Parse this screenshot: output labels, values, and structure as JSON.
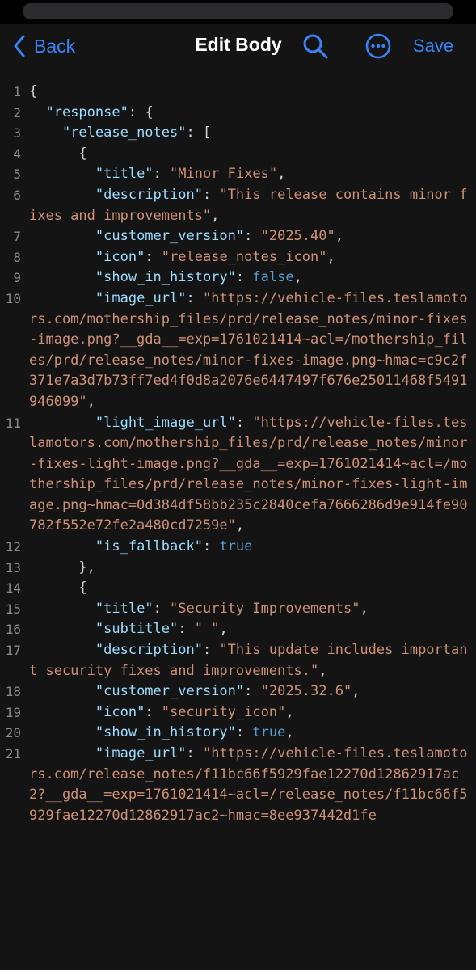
{
  "nav": {
    "back_label": "Back",
    "title": "Edit Body",
    "save_label": "Save",
    "search_icon": "search-icon",
    "more_icon": "ellipsis-circle-icon",
    "accent": "#3b82f6"
  },
  "editor": {
    "lines": [
      {
        "n": "1",
        "segments": [
          {
            "t": "p",
            "v": "{"
          }
        ]
      },
      {
        "n": "2",
        "segments": [
          {
            "t": "p",
            "v": "  "
          },
          {
            "t": "k",
            "v": "\"response\""
          },
          {
            "t": "p",
            "v": ": {"
          }
        ]
      },
      {
        "n": "3",
        "segments": [
          {
            "t": "p",
            "v": "    "
          },
          {
            "t": "k",
            "v": "\"release_notes\""
          },
          {
            "t": "p",
            "v": ": ["
          }
        ]
      },
      {
        "n": "4",
        "segments": [
          {
            "t": "p",
            "v": "      {"
          }
        ]
      },
      {
        "n": "5",
        "segments": [
          {
            "t": "p",
            "v": "        "
          },
          {
            "t": "k",
            "v": "\"title\""
          },
          {
            "t": "p",
            "v": ": "
          },
          {
            "t": "s",
            "v": "\"Minor Fixes\""
          },
          {
            "t": "p",
            "v": ","
          }
        ]
      },
      {
        "n": "6",
        "segments": [
          {
            "t": "p",
            "v": "        "
          },
          {
            "t": "k",
            "v": "\"description\""
          },
          {
            "t": "p",
            "v": ": "
          },
          {
            "t": "s",
            "v": "\"This release contains minor fixes and improvements\""
          },
          {
            "t": "p",
            "v": ","
          }
        ]
      },
      {
        "n": "7",
        "segments": [
          {
            "t": "p",
            "v": "        "
          },
          {
            "t": "k",
            "v": "\"customer_version\""
          },
          {
            "t": "p",
            "v": ": "
          },
          {
            "t": "s",
            "v": "\"2025.40\""
          },
          {
            "t": "p",
            "v": ","
          }
        ]
      },
      {
        "n": "8",
        "segments": [
          {
            "t": "p",
            "v": "        "
          },
          {
            "t": "k",
            "v": "\"icon\""
          },
          {
            "t": "p",
            "v": ": "
          },
          {
            "t": "s",
            "v": "\"release_notes_icon\""
          },
          {
            "t": "p",
            "v": ","
          }
        ]
      },
      {
        "n": "9",
        "segments": [
          {
            "t": "p",
            "v": "        "
          },
          {
            "t": "k",
            "v": "\"show_in_history\""
          },
          {
            "t": "p",
            "v": ": "
          },
          {
            "t": "kw",
            "v": "false"
          },
          {
            "t": "p",
            "v": ","
          }
        ]
      },
      {
        "n": "10",
        "segments": [
          {
            "t": "p",
            "v": "        "
          },
          {
            "t": "k",
            "v": "\"image_url\""
          },
          {
            "t": "p",
            "v": ": "
          },
          {
            "t": "s",
            "v": "\"https://vehicle-files.teslamotors.com/mothership_files/prd/release_notes/minor-fixes-image.png?__gda__=exp=1761021414~acl=/mothership_files/prd/release_notes/minor-fixes-image.png~hmac=c9c2f371e7a3d7b73ff7ed4f0d8a2076e6447497f676e25011468f5491946099\""
          },
          {
            "t": "p",
            "v": ","
          }
        ]
      },
      {
        "n": "11",
        "segments": [
          {
            "t": "p",
            "v": "        "
          },
          {
            "t": "k",
            "v": "\"light_image_url\""
          },
          {
            "t": "p",
            "v": ": "
          },
          {
            "t": "s",
            "v": "\"https://vehicle-files.teslamotors.com/mothership_files/prd/release_notes/minor-fixes-light-image.png?__gda__=exp=1761021414~acl=/mothership_files/prd/release_notes/minor-fixes-light-image.png~hmac=0d384df58bb235c2840cefa7666286d9e914fe90782f552e72fe2a480cd7259e\""
          },
          {
            "t": "p",
            "v": ","
          }
        ]
      },
      {
        "n": "12",
        "segments": [
          {
            "t": "p",
            "v": "        "
          },
          {
            "t": "k",
            "v": "\"is_fallback\""
          },
          {
            "t": "p",
            "v": ": "
          },
          {
            "t": "kw",
            "v": "true"
          }
        ]
      },
      {
        "n": "13",
        "segments": [
          {
            "t": "p",
            "v": "      },"
          }
        ]
      },
      {
        "n": "14",
        "segments": [
          {
            "t": "p",
            "v": "      {"
          }
        ]
      },
      {
        "n": "15",
        "segments": [
          {
            "t": "p",
            "v": "        "
          },
          {
            "t": "k",
            "v": "\"title\""
          },
          {
            "t": "p",
            "v": ": "
          },
          {
            "t": "s",
            "v": "\"Security Improvements\""
          },
          {
            "t": "p",
            "v": ","
          }
        ]
      },
      {
        "n": "16",
        "segments": [
          {
            "t": "p",
            "v": "        "
          },
          {
            "t": "k",
            "v": "\"subtitle\""
          },
          {
            "t": "p",
            "v": ": "
          },
          {
            "t": "s",
            "v": "\" \""
          },
          {
            "t": "p",
            "v": ","
          }
        ]
      },
      {
        "n": "17",
        "segments": [
          {
            "t": "p",
            "v": "        "
          },
          {
            "t": "k",
            "v": "\"description\""
          },
          {
            "t": "p",
            "v": ": "
          },
          {
            "t": "s",
            "v": "\"This update includes important security fixes and improvements.\""
          },
          {
            "t": "p",
            "v": ","
          }
        ]
      },
      {
        "n": "18",
        "segments": [
          {
            "t": "p",
            "v": "        "
          },
          {
            "t": "k",
            "v": "\"customer_version\""
          },
          {
            "t": "p",
            "v": ": "
          },
          {
            "t": "s",
            "v": "\"2025.32.6\""
          },
          {
            "t": "p",
            "v": ","
          }
        ]
      },
      {
        "n": "19",
        "segments": [
          {
            "t": "p",
            "v": "        "
          },
          {
            "t": "k",
            "v": "\"icon\""
          },
          {
            "t": "p",
            "v": ": "
          },
          {
            "t": "s",
            "v": "\"security_icon\""
          },
          {
            "t": "p",
            "v": ","
          }
        ]
      },
      {
        "n": "20",
        "segments": [
          {
            "t": "p",
            "v": "        "
          },
          {
            "t": "k",
            "v": "\"show_in_history\""
          },
          {
            "t": "p",
            "v": ": "
          },
          {
            "t": "kw",
            "v": "true"
          },
          {
            "t": "p",
            "v": ","
          }
        ]
      },
      {
        "n": "21",
        "segments": [
          {
            "t": "p",
            "v": "        "
          },
          {
            "t": "k",
            "v": "\"image_url\""
          },
          {
            "t": "p",
            "v": ": "
          },
          {
            "t": "s",
            "v": "\"https://vehicle-files.teslamotors.com/release_notes/f11bc66f5929fae12270d12862917ac2?__gda__=exp=1761021414~acl=/release_notes/f11bc66f5929fae12270d12862917ac2~hmac=8ee937442d1fe"
          }
        ]
      }
    ]
  }
}
